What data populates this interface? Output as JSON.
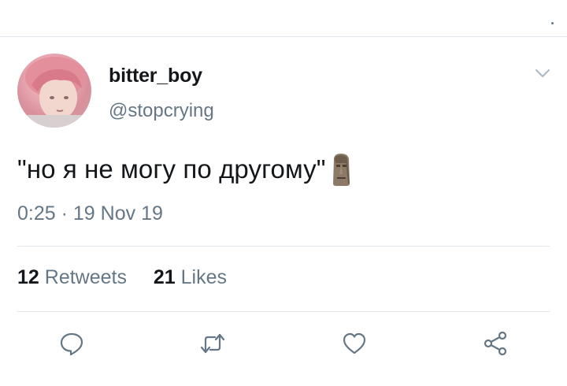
{
  "tweet": {
    "author": {
      "display_name": "bitter_boy",
      "handle": "@stopcrying"
    },
    "text": "\"но я не могу по другому\"",
    "emoji": "moai",
    "time": "0:25",
    "separator": "·",
    "date": "19 Nov 19",
    "retweets_count": "12",
    "retweets_label": "Retweets",
    "likes_count": "21",
    "likes_label": "Likes"
  },
  "icons": {
    "menu": "chevron-down-icon",
    "reply": "reply-icon",
    "retweet": "retweet-icon",
    "like": "heart-icon",
    "share": "share-icon"
  },
  "colors": {
    "text_primary": "#14171a",
    "text_secondary": "#657786",
    "divider": "#e1e8ed",
    "icon": "#657786"
  }
}
